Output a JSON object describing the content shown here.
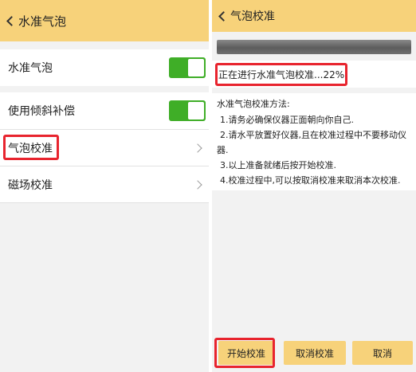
{
  "left": {
    "title": "水准气泡",
    "rows": [
      {
        "label": "水准气泡",
        "toggle": true
      },
      {
        "label": "使用倾斜补偿",
        "toggle": true
      },
      {
        "label": "气泡校准",
        "arrow": true
      },
      {
        "label": "磁场校准",
        "arrow": true
      }
    ]
  },
  "right": {
    "title": "气泡校准",
    "progress_percent": 22,
    "status": "正在进行水准气泡校准...22%",
    "instructions": {
      "heading": "水准气泡校准方法:",
      "lines": [
        "1.请务必确保仪器正面朝向你自己.",
        "2.请水平放置好仪器,且在校准过程中不要移动仪",
        "器.",
        "3.以上准备就绪后按开始校准.",
        "4.校准过程中,可以按取消校准来取消本次校准."
      ]
    },
    "buttons": {
      "start": "开始校准",
      "cancel_calib": "取消校准",
      "cancel": "取消"
    }
  },
  "colors": {
    "header": "#f7d27a",
    "toggle_on": "#3fae27",
    "highlight": "#e8242e"
  }
}
